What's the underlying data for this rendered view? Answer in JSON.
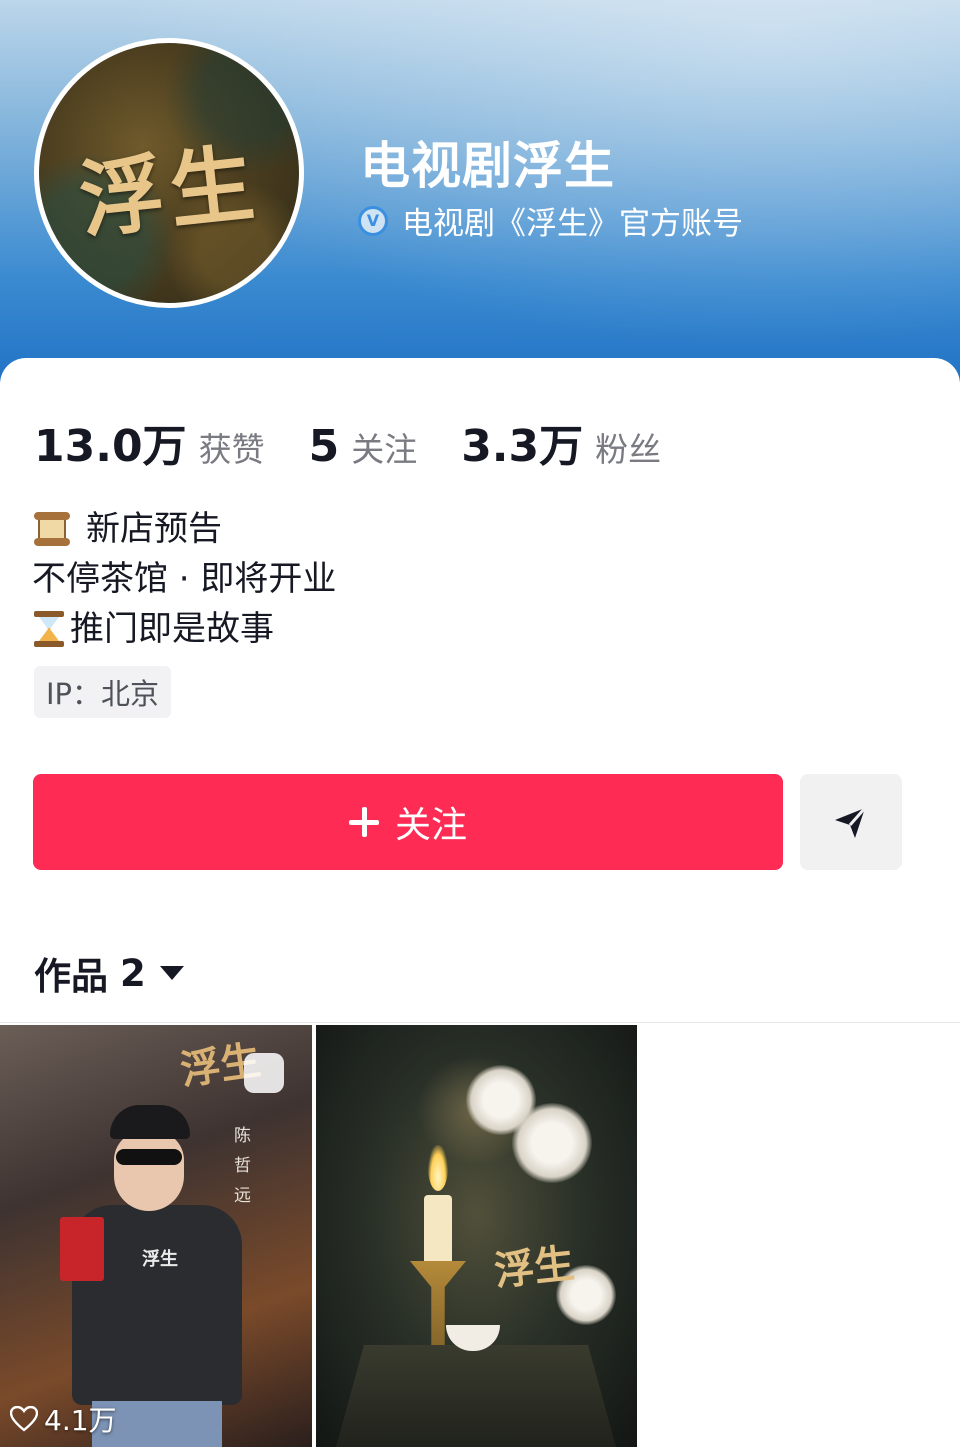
{
  "header": {
    "avatar_text": "浮生",
    "title": "电视剧浮生",
    "verified_badge": "V",
    "verified_text": "电视剧《浮生》官方账号",
    "colors": {
      "banner_top": "#bcd6ea",
      "banner_bottom": "#1d6fc4"
    }
  },
  "stats": [
    {
      "value": "13.0万",
      "label": "获赞"
    },
    {
      "value": "5",
      "label": "关注"
    },
    {
      "value": "3.3万",
      "label": "粉丝"
    }
  ],
  "bio": {
    "line1_icon": "scroll-emoji",
    "line1": "新店预告",
    "line2": "不停茶馆 · 即将开业",
    "line3_icon": "hourglass-emoji",
    "line3": "推门即是故事"
  },
  "ip_tag": "IP：北京",
  "actions": {
    "follow_label": "关注",
    "follow_icon": "plus-icon",
    "share_icon": "send-icon",
    "accent": "#fe2c55"
  },
  "works": {
    "label": "作品",
    "count": "2",
    "dropdown_icon": "caret-down-icon"
  },
  "videos": [
    {
      "title_art": "浮生",
      "name_text": [
        "陈",
        "哲",
        "远"
      ],
      "likes": "4.1万",
      "pinned": true
    },
    {
      "title_art": "浮生",
      "likes": ""
    }
  ]
}
